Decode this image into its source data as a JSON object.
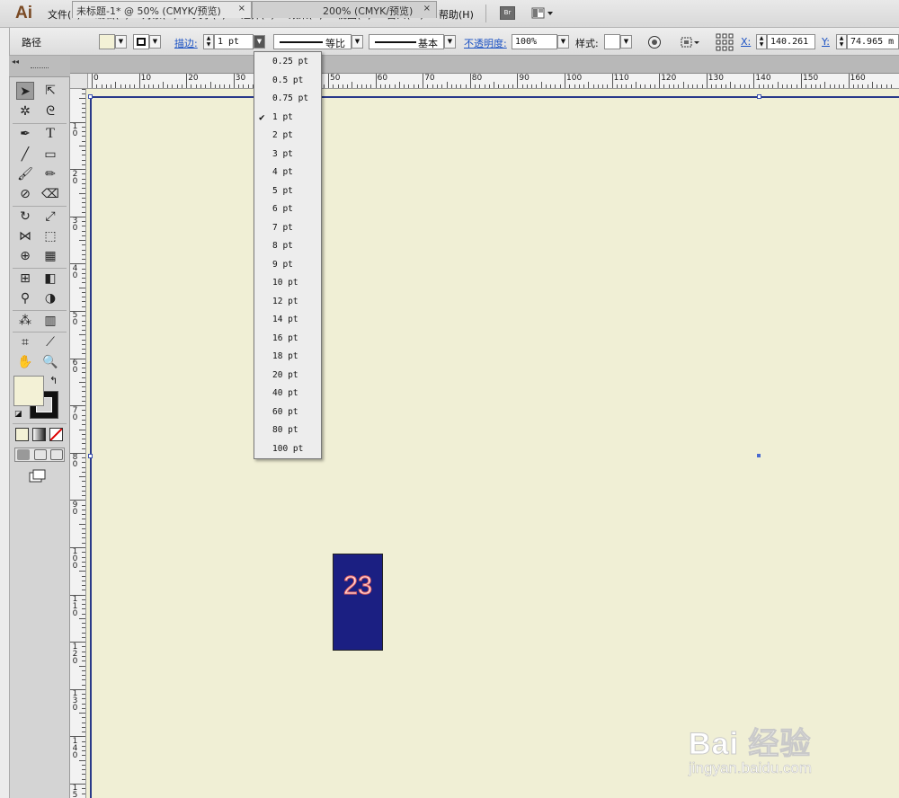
{
  "app": {
    "logo": "Ai"
  },
  "menu": [
    "文件(F)",
    "编辑(E)",
    "对象(O)",
    "文字(T)",
    "选择(S)",
    "效果(C)",
    "视图(V)",
    "窗口(W)",
    "帮助(H)"
  ],
  "menu_bridge": "Br",
  "control": {
    "selection_label": "路径",
    "stroke_link": "描边:",
    "stroke_value": "1 pt",
    "profile_label": "等比",
    "brush_label": "基本",
    "opacity_link": "不透明度:",
    "opacity_value": "100%",
    "style_label": "样式:",
    "x_label": "X:",
    "x_value": "140.261",
    "y_label": "Y:",
    "y_value": "74.965 m",
    "fill_color": "#f3f1d6"
  },
  "tabs": [
    {
      "label": "未标题-1* @ 50% (CMYK/预览)",
      "close": "×"
    },
    {
      "label": "200% (CMYK/预览)",
      "close": "×"
    }
  ],
  "ruler": {
    "h_labels": [
      "0",
      "10",
      "20",
      "30",
      "40",
      "50",
      "60",
      "70",
      "80",
      "90",
      "100",
      "110",
      "120",
      "130",
      "140",
      "150",
      "160"
    ],
    "v_labels": [
      "1\n0",
      "2\n0",
      "3\n0",
      "4\n0",
      "5\n0",
      "6\n0",
      "7\n0",
      "8\n0",
      "9\n0",
      "1\n0\n0",
      "1\n1\n0",
      "1\n2\n0",
      "1\n3\n0",
      "1\n4\n0",
      "1\n5"
    ]
  },
  "stroke_dropdown": {
    "items": [
      "0.25 pt",
      "0.5 pt",
      "0.75 pt",
      "1 pt",
      "2 pt",
      "3 pt",
      "4 pt",
      "5 pt",
      "6 pt",
      "7 pt",
      "8 pt",
      "9 pt",
      "10 pt",
      "12 pt",
      "14 pt",
      "16 pt",
      "18 pt",
      "20 pt",
      "40 pt",
      "60 pt",
      "80 pt",
      "100 pt"
    ],
    "selected": "1 pt",
    "check_mark": "✔"
  },
  "canvas": {
    "background": "#f0efd5",
    "shape_text": "23",
    "shape_color": "#1b1f82"
  },
  "watermark": {
    "line1": "Bai 经验",
    "line2": "jingyan.baidu.com"
  }
}
